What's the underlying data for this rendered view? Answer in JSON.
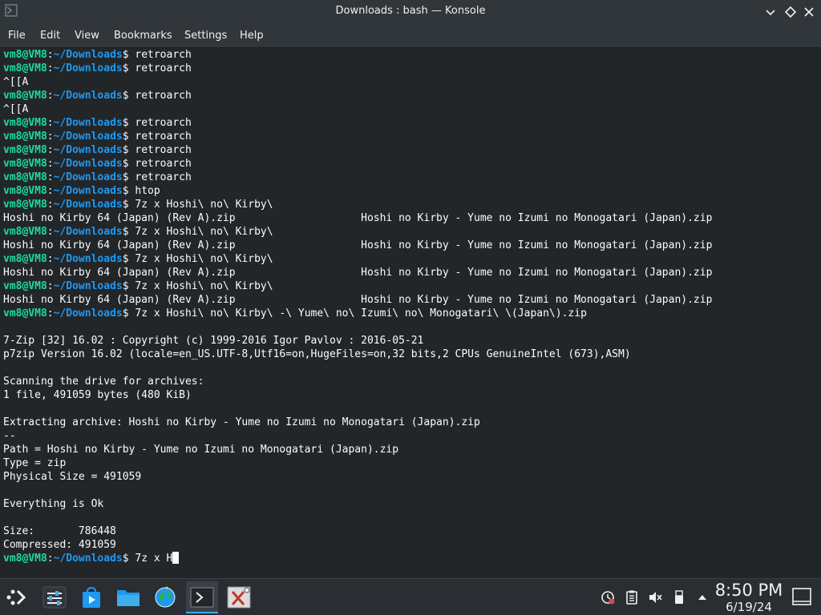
{
  "window": {
    "title": "Downloads : bash — Konsole"
  },
  "menu": [
    {
      "label": "File"
    },
    {
      "label": "Edit"
    },
    {
      "label": "View"
    },
    {
      "label": "Bookmarks"
    },
    {
      "label": "Settings"
    },
    {
      "label": "Help"
    }
  ],
  "terminal": {
    "lines": [
      [
        {
          "t": "user",
          "v": "vm8@VM8"
        },
        {
          "t": "host",
          "v": ":"
        },
        {
          "t": "path",
          "v": "~/Downloads"
        },
        {
          "t": "plain",
          "v": "$ retroarch"
        }
      ],
      [
        {
          "t": "user",
          "v": "vm8@VM8"
        },
        {
          "t": "host",
          "v": ":"
        },
        {
          "t": "path",
          "v": "~/Downloads"
        },
        {
          "t": "plain",
          "v": "$ retroarch"
        }
      ],
      [
        {
          "t": "plain",
          "v": "^[[A"
        }
      ],
      [
        {
          "t": "user",
          "v": "vm8@VM8"
        },
        {
          "t": "host",
          "v": ":"
        },
        {
          "t": "path",
          "v": "~/Downloads"
        },
        {
          "t": "plain",
          "v": "$ retroarch"
        }
      ],
      [
        {
          "t": "plain",
          "v": "^[[A"
        }
      ],
      [
        {
          "t": "user",
          "v": "vm8@VM8"
        },
        {
          "t": "host",
          "v": ":"
        },
        {
          "t": "path",
          "v": "~/Downloads"
        },
        {
          "t": "plain",
          "v": "$ retroarch"
        }
      ],
      [
        {
          "t": "user",
          "v": "vm8@VM8"
        },
        {
          "t": "host",
          "v": ":"
        },
        {
          "t": "path",
          "v": "~/Downloads"
        },
        {
          "t": "plain",
          "v": "$ retroarch"
        }
      ],
      [
        {
          "t": "user",
          "v": "vm8@VM8"
        },
        {
          "t": "host",
          "v": ":"
        },
        {
          "t": "path",
          "v": "~/Downloads"
        },
        {
          "t": "plain",
          "v": "$ retroarch"
        }
      ],
      [
        {
          "t": "user",
          "v": "vm8@VM8"
        },
        {
          "t": "host",
          "v": ":"
        },
        {
          "t": "path",
          "v": "~/Downloads"
        },
        {
          "t": "plain",
          "v": "$ retroarch"
        }
      ],
      [
        {
          "t": "user",
          "v": "vm8@VM8"
        },
        {
          "t": "host",
          "v": ":"
        },
        {
          "t": "path",
          "v": "~/Downloads"
        },
        {
          "t": "plain",
          "v": "$ retroarch"
        }
      ],
      [
        {
          "t": "user",
          "v": "vm8@VM8"
        },
        {
          "t": "host",
          "v": ":"
        },
        {
          "t": "path",
          "v": "~/Downloads"
        },
        {
          "t": "plain",
          "v": "$ htop"
        }
      ],
      [
        {
          "t": "user",
          "v": "vm8@VM8"
        },
        {
          "t": "host",
          "v": ":"
        },
        {
          "t": "path",
          "v": "~/Downloads"
        },
        {
          "t": "plain",
          "v": "$ 7z x Hoshi\\ no\\ Kirby\\"
        }
      ],
      [
        {
          "t": "plain",
          "v": "Hoshi no Kirby 64 (Japan) (Rev A).zip                    Hoshi no Kirby - Yume no Izumi no Monogatari (Japan).zip"
        }
      ],
      [
        {
          "t": "user",
          "v": "vm8@VM8"
        },
        {
          "t": "host",
          "v": ":"
        },
        {
          "t": "path",
          "v": "~/Downloads"
        },
        {
          "t": "plain",
          "v": "$ 7z x Hoshi\\ no\\ Kirby\\"
        }
      ],
      [
        {
          "t": "plain",
          "v": "Hoshi no Kirby 64 (Japan) (Rev A).zip                    Hoshi no Kirby - Yume no Izumi no Monogatari (Japan).zip"
        }
      ],
      [
        {
          "t": "user",
          "v": "vm8@VM8"
        },
        {
          "t": "host",
          "v": ":"
        },
        {
          "t": "path",
          "v": "~/Downloads"
        },
        {
          "t": "plain",
          "v": "$ 7z x Hoshi\\ no\\ Kirby\\"
        }
      ],
      [
        {
          "t": "plain",
          "v": "Hoshi no Kirby 64 (Japan) (Rev A).zip                    Hoshi no Kirby - Yume no Izumi no Monogatari (Japan).zip"
        }
      ],
      [
        {
          "t": "user",
          "v": "vm8@VM8"
        },
        {
          "t": "host",
          "v": ":"
        },
        {
          "t": "path",
          "v": "~/Downloads"
        },
        {
          "t": "plain",
          "v": "$ 7z x Hoshi\\ no\\ Kirby\\"
        }
      ],
      [
        {
          "t": "plain",
          "v": "Hoshi no Kirby 64 (Japan) (Rev A).zip                    Hoshi no Kirby - Yume no Izumi no Monogatari (Japan).zip"
        }
      ],
      [
        {
          "t": "user",
          "v": "vm8@VM8"
        },
        {
          "t": "host",
          "v": ":"
        },
        {
          "t": "path",
          "v": "~/Downloads"
        },
        {
          "t": "plain",
          "v": "$ 7z x Hoshi\\ no\\ Kirby\\ -\\ Yume\\ no\\ Izumi\\ no\\ Monogatari\\ \\(Japan\\).zip"
        }
      ],
      [
        {
          "t": "plain",
          "v": ""
        }
      ],
      [
        {
          "t": "plain",
          "v": "7-Zip [32] 16.02 : Copyright (c) 1999-2016 Igor Pavlov : 2016-05-21"
        }
      ],
      [
        {
          "t": "plain",
          "v": "p7zip Version 16.02 (locale=en_US.UTF-8,Utf16=on,HugeFiles=on,32 bits,2 CPUs GenuineIntel (673),ASM)"
        }
      ],
      [
        {
          "t": "plain",
          "v": ""
        }
      ],
      [
        {
          "t": "plain",
          "v": "Scanning the drive for archives:"
        }
      ],
      [
        {
          "t": "plain",
          "v": "1 file, 491059 bytes (480 KiB)"
        }
      ],
      [
        {
          "t": "plain",
          "v": ""
        }
      ],
      [
        {
          "t": "plain",
          "v": "Extracting archive: Hoshi no Kirby - Yume no Izumi no Monogatari (Japan).zip"
        }
      ],
      [
        {
          "t": "plain",
          "v": "--"
        }
      ],
      [
        {
          "t": "plain",
          "v": "Path = Hoshi no Kirby - Yume no Izumi no Monogatari (Japan).zip"
        }
      ],
      [
        {
          "t": "plain",
          "v": "Type = zip"
        }
      ],
      [
        {
          "t": "plain",
          "v": "Physical Size = 491059"
        }
      ],
      [
        {
          "t": "plain",
          "v": ""
        }
      ],
      [
        {
          "t": "plain",
          "v": "Everything is Ok"
        }
      ],
      [
        {
          "t": "plain",
          "v": ""
        }
      ],
      [
        {
          "t": "plain",
          "v": "Size:       786448"
        }
      ],
      [
        {
          "t": "plain",
          "v": "Compressed: 491059"
        }
      ],
      [
        {
          "t": "user",
          "v": "vm8@VM8"
        },
        {
          "t": "host",
          "v": ":"
        },
        {
          "t": "path",
          "v": "~/Downloads"
        },
        {
          "t": "plain",
          "v": "$ 7z x H"
        },
        {
          "t": "cursor",
          "v": ""
        }
      ]
    ]
  },
  "taskbar": {
    "launcher_icon": "kde-application-launcher-icon",
    "apps": [
      {
        "name": "system-settings-icon",
        "active": false
      },
      {
        "name": "discover-store-icon",
        "active": false
      },
      {
        "name": "dolphin-folder-icon",
        "active": false
      },
      {
        "name": "web-browser-globe-icon",
        "active": false
      },
      {
        "name": "konsole-terminal-icon",
        "active": true
      },
      {
        "name": "x-app-icon",
        "active": false
      }
    ],
    "tray": [
      {
        "name": "notification-icon"
      },
      {
        "name": "clipboard-icon"
      },
      {
        "name": "volume-muted-icon"
      },
      {
        "name": "removable-device-icon"
      },
      {
        "name": "show-hidden-arrow-icon"
      }
    ],
    "clock": {
      "time": "8:50 PM",
      "date": "6/19/24"
    }
  },
  "colors": {
    "background": "#232629",
    "bar": "#31363b",
    "prompt_user": "#1cdc9a",
    "prompt_path": "#1d99f3",
    "text": "#fcfcfc",
    "accent": "#3daee9"
  }
}
